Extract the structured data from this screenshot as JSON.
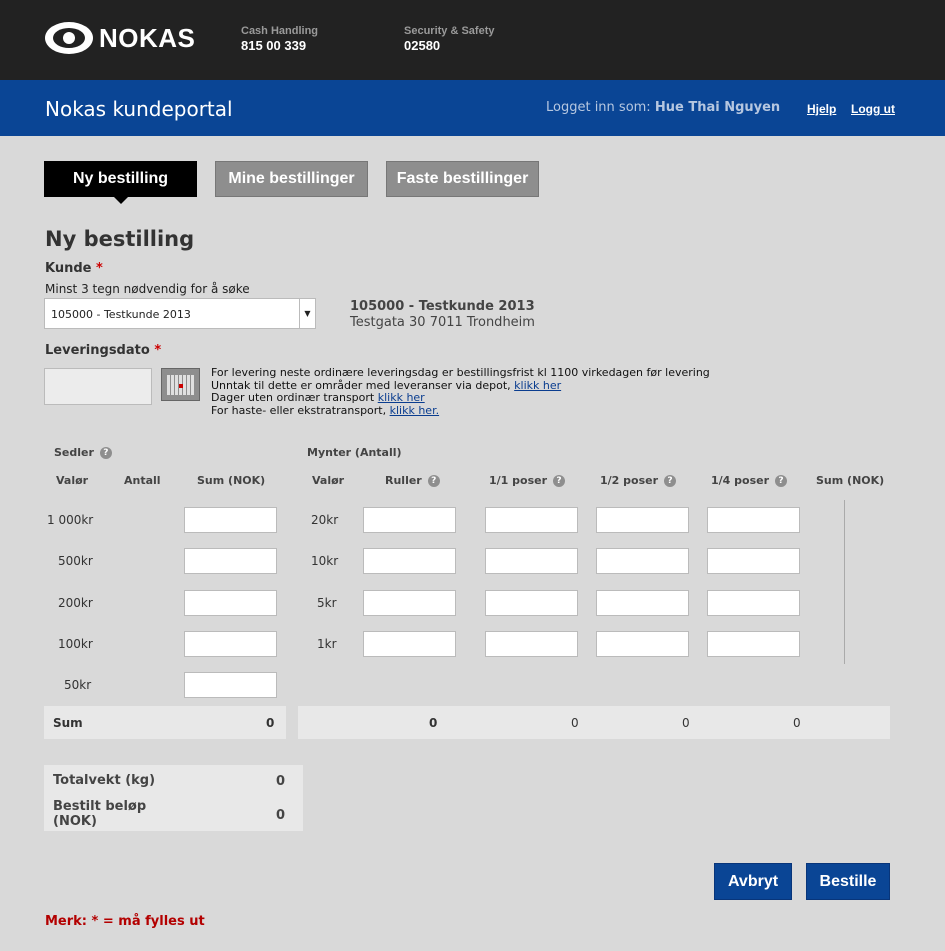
{
  "header": {
    "logo_text": "NOKAS",
    "cash_label": "Cash Handling",
    "cash_value": "815 00 339",
    "security_label": "Security & Safety",
    "security_value": "02580"
  },
  "nav": {
    "portal_title": "Nokas kundeportal",
    "logged_in_prefix": "Logget inn som:",
    "user_name": "Hue Thai Nguyen",
    "help": "Hjelp",
    "logout": "Logg ut"
  },
  "tabs": [
    "Ny bestilling",
    "Mine bestillinger",
    "Faste bestillinger"
  ],
  "form": {
    "heading": "Ny bestilling",
    "kunde_label": "Kunde",
    "required_mark": "*",
    "kunde_hint": "Minst 3 tegn nødvendig for å søke",
    "kunde_selected": "105000 - Testkunde 2013",
    "customer_name": "105000 - Testkunde 2013",
    "customer_address": "Testgata 30 7011 Trondheim",
    "date_label": "Leveringsdato",
    "date_value": "",
    "info": {
      "line1": "For levering neste ordinære leveringsdag er bestillingsfrist kl 1100 virkedagen før levering",
      "line2_text": "Unntak til dette er områder med leveranser via depot, ",
      "line2_link": "klikk her",
      "line3_text": "Dager uten ordinær transport ",
      "line3_link": "klikk her",
      "line4_text": "For haste- eller ekstratransport, ",
      "line4_link": "klikk her."
    }
  },
  "notes_table": {
    "section": "Sedler",
    "col_value": "Valør",
    "col_count": "Antall",
    "col_sum": "Sum (NOK)",
    "rows": [
      "1 000kr",
      "500kr",
      "200kr",
      "100kr",
      "50kr"
    ],
    "sum_label": "Sum",
    "sum_value": "0"
  },
  "coins_table": {
    "section": "Mynter (Antall)",
    "col_value": "Valør",
    "col_rolls": "Ruller",
    "col_full": "1/1 poser",
    "col_half": "1/2 poser",
    "col_quarter": "1/4 poser",
    "col_sum": "Sum (NOK)",
    "rows": [
      "20kr",
      "10kr",
      "5kr",
      "1kr"
    ],
    "sums": [
      "0",
      "0",
      "0",
      "0"
    ]
  },
  "totals": {
    "weight_label": "Totalvekt (kg)",
    "weight_value": "0",
    "amount_label_1": "Bestilt beløp",
    "amount_label_2": "(NOK)",
    "amount_value": "0"
  },
  "actions": {
    "cancel": "Avbryt",
    "order": "Bestille"
  },
  "footer_note": "Merk: * = må fylles ut",
  "help_glyph": "?",
  "colors": {
    "top_bar": "#222222",
    "brand_blue": "#0a4595",
    "required_red": "#cc0000",
    "background": "#d9d9d9"
  }
}
